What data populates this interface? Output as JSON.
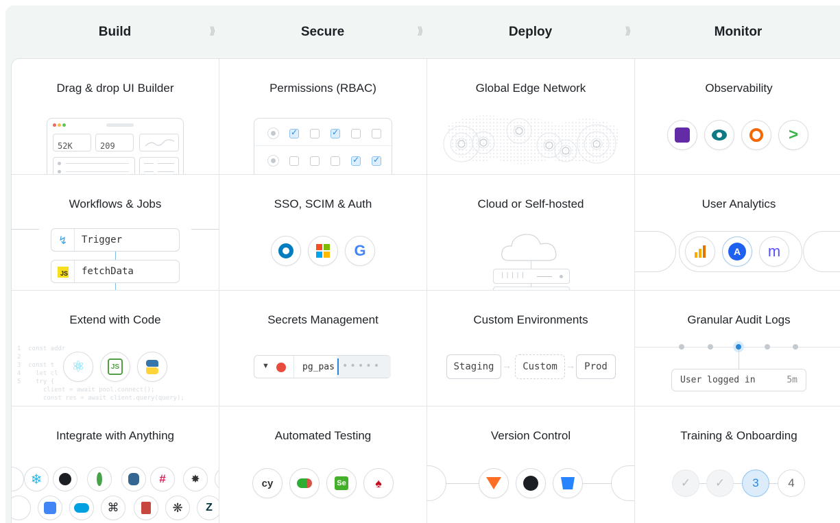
{
  "stages": [
    "Build",
    "Secure",
    "Deploy",
    "Monitor"
  ],
  "cells": {
    "ui_builder": {
      "title": "Drag & drop UI Builder",
      "stat1": "52K",
      "stat2": "209"
    },
    "rbac": {
      "title": "Permissions (RBAC)"
    },
    "edge": {
      "title": "Global Edge Network"
    },
    "observability": {
      "title": "Observability",
      "icons": [
        "datadog-icon",
        "eye-icon",
        "grafana-icon",
        "prompt-icon"
      ]
    },
    "workflows": {
      "title": "Workflows & Jobs",
      "step1": "Trigger",
      "step2": "fetchData",
      "js_badge": "JS"
    },
    "sso": {
      "title": "SSO, SCIM & Auth",
      "icons": [
        "okta-icon",
        "microsoft-icon",
        "google-icon"
      ]
    },
    "cloud": {
      "title": "Cloud or Self-hosted"
    },
    "analytics": {
      "title": "User Analytics",
      "icons": [
        "bar-chart-icon",
        "amplitude-icon",
        "mixpanel-icon"
      ]
    },
    "extend": {
      "title": "Extend with Code",
      "icons": [
        "react-icon",
        "nodejs-icon",
        "python-icon"
      ]
    },
    "secrets": {
      "title": "Secrets Management",
      "value": "pg_pas"
    },
    "envs": {
      "title": "Custom Environments",
      "env1": "Staging",
      "env2": "Custom",
      "env3": "Prod"
    },
    "audit": {
      "title": "Granular Audit Logs",
      "event": "User logged in",
      "time": "5m"
    },
    "integrate": {
      "title": "Integrate with Anything"
    },
    "testing": {
      "title": "Automated Testing",
      "icons": [
        "cypress-icon",
        "playwright-icon",
        "selenium-icon",
        "jest-icon"
      ]
    },
    "vcs": {
      "title": "Version Control",
      "icons": [
        "gitlab-icon",
        "github-icon",
        "bitbucket-icon"
      ]
    },
    "training": {
      "title": "Training & Onboarding",
      "step3": "3",
      "step4": "4"
    }
  },
  "colors": {
    "accent": "#2b88d9",
    "band": "#f1f6f5",
    "border": "#e2e5e8"
  }
}
